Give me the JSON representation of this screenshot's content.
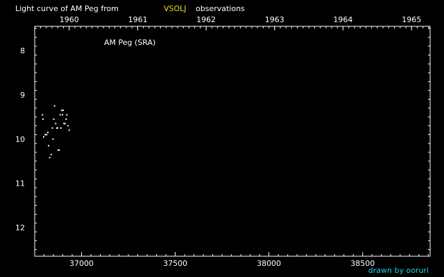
{
  "chart_data": {
    "type": "scatter",
    "title_prefix": "Light curve of AM Peg from",
    "title_source": "VSOLJ",
    "title_suffix": "observations",
    "inner_label": "AM Peg (SRA)",
    "credit": "drawn by ooruri",
    "colors": {
      "background": "#000000",
      "axis": "#ffffff",
      "points": "#ffffff",
      "source": "#e8e020",
      "credit": "#19d2e6"
    },
    "xlim": [
      36750,
      38860
    ],
    "ylim": [
      12.65,
      7.45
    ],
    "x_ticks": [
      37000,
      37500,
      38000,
      38500
    ],
    "y_ticks": [
      8,
      9,
      10,
      11,
      12
    ],
    "top_axis": {
      "years": [
        "1960",
        "1961",
        "1962",
        "1963",
        "1964",
        "1965"
      ],
      "jd_at_year": [
        36934,
        37300,
        37665,
        38030,
        38395,
        38761
      ]
    },
    "points": [
      {
        "x": 36792,
        "y": 9.45
      },
      {
        "x": 36794,
        "y": 9.55
      },
      {
        "x": 36798,
        "y": 9.95
      },
      {
        "x": 36806,
        "y": 9.9
      },
      {
        "x": 36814,
        "y": 9.9
      },
      {
        "x": 36820,
        "y": 9.85
      },
      {
        "x": 36824,
        "y": 10.15
      },
      {
        "x": 36830,
        "y": 10.42
      },
      {
        "x": 36838,
        "y": 10.35
      },
      {
        "x": 36844,
        "y": 9.75
      },
      {
        "x": 36848,
        "y": 10.0
      },
      {
        "x": 36852,
        "y": 9.55
      },
      {
        "x": 36856,
        "y": 9.25
      },
      {
        "x": 36862,
        "y": 9.65
      },
      {
        "x": 36868,
        "y": 9.75
      },
      {
        "x": 36872,
        "y": 9.75
      },
      {
        "x": 36876,
        "y": 10.25
      },
      {
        "x": 36880,
        "y": 10.25
      },
      {
        "x": 36886,
        "y": 9.45
      },
      {
        "x": 36890,
        "y": 9.75
      },
      {
        "x": 36894,
        "y": 9.35
      },
      {
        "x": 36898,
        "y": 9.45
      },
      {
        "x": 36902,
        "y": 9.35
      },
      {
        "x": 36906,
        "y": 9.65
      },
      {
        "x": 36912,
        "y": 9.65
      },
      {
        "x": 36918,
        "y": 9.55
      },
      {
        "x": 36922,
        "y": 9.45
      },
      {
        "x": 36928,
        "y": 9.7
      },
      {
        "x": 36934,
        "y": 9.8
      }
    ]
  }
}
